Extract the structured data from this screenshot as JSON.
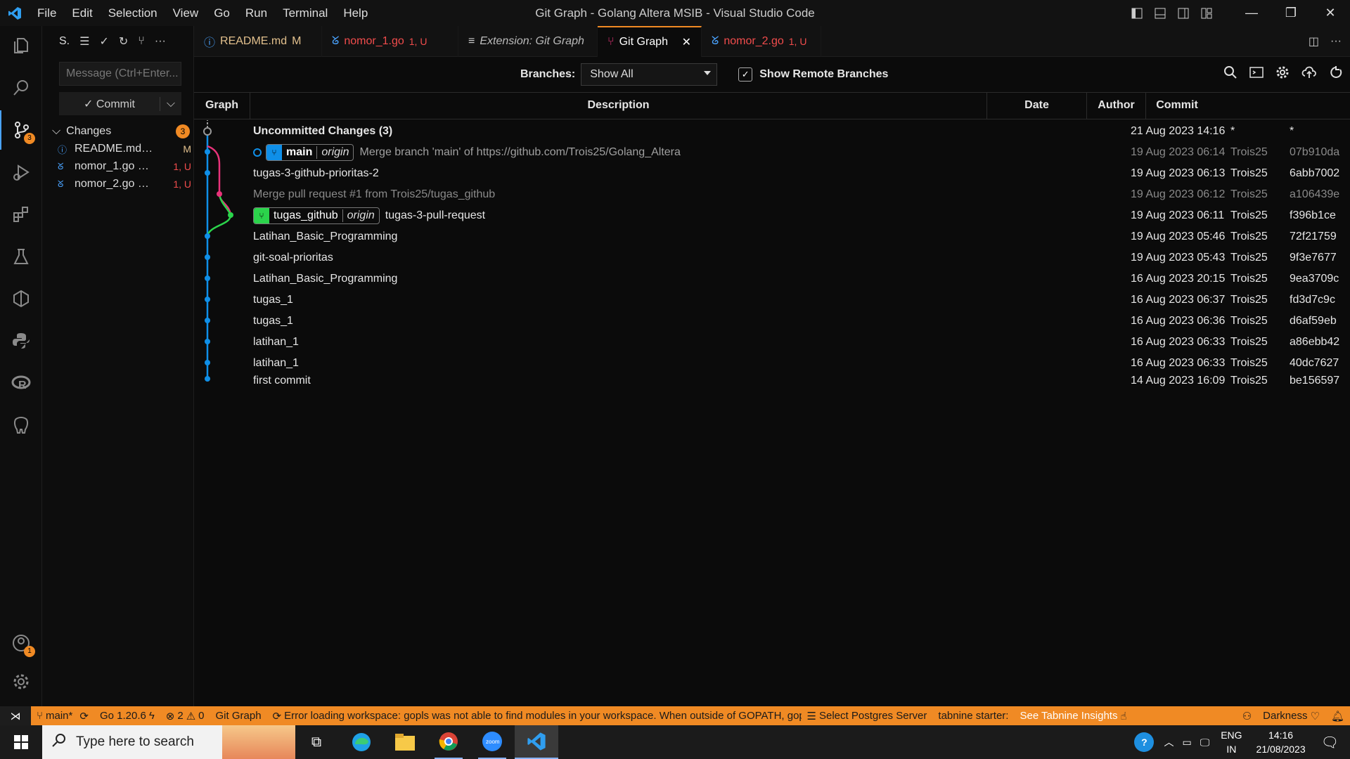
{
  "window": {
    "title": "Git Graph - Golang Altera MSIB - Visual Studio Code"
  },
  "menu": [
    "File",
    "Edit",
    "Selection",
    "View",
    "Go",
    "Run",
    "Terminal",
    "Help"
  ],
  "scm": {
    "title_initial": "S.",
    "message_placeholder": "Message (Ctrl+Enter...",
    "commit_label": "Commit",
    "changes_label": "Changes",
    "changes_count": "3",
    "files": [
      {
        "name": "README.md",
        "path": "4_...",
        "status": "M"
      },
      {
        "name": "nomor_1.go",
        "path": "4...",
        "status": "1, U"
      },
      {
        "name": "nomor_2.go",
        "path": "4...",
        "status": "1, U"
      }
    ]
  },
  "tabs": [
    {
      "label": "README.md",
      "status": "M"
    },
    {
      "label": "nomor_1.go",
      "status": "1, U"
    },
    {
      "label": "Extension: Git Graph",
      "status": ""
    },
    {
      "label": "Git Graph",
      "status": ""
    },
    {
      "label": "nomor_2.go",
      "status": "1, U"
    }
  ],
  "controls": {
    "branches_label": "Branches:",
    "branches_value": "Show All",
    "show_remote_label": "Show Remote Branches"
  },
  "columns": {
    "graph": "Graph",
    "description": "Description",
    "date": "Date",
    "author": "Author",
    "commit": "Commit"
  },
  "rows": [
    {
      "desc": "Uncommitted Changes (3)",
      "date": "21 Aug 2023 14:16",
      "author": "*",
      "hash": "*"
    },
    {
      "branch": "main",
      "remote": "origin",
      "desc": "Merge branch 'main' of https://github.com/Trois25/Golang_Altera",
      "date": "19 Aug 2023 06:14",
      "author": "Trois25",
      "hash": "07b910da"
    },
    {
      "desc": "tugas-3-github-prioritas-2",
      "date": "19 Aug 2023 06:13",
      "author": "Trois25",
      "hash": "6abb7002"
    },
    {
      "desc": "Merge pull request #1 from Trois25/tugas_github",
      "date": "19 Aug 2023 06:12",
      "author": "Trois25",
      "hash": "a106439e"
    },
    {
      "branch": "tugas_github",
      "remote": "origin",
      "desc": "tugas-3-pull-request",
      "date": "19 Aug 2023 06:11",
      "author": "Trois25",
      "hash": "f396b1ce"
    },
    {
      "desc": "Latihan_Basic_Programming",
      "date": "19 Aug 2023 05:46",
      "author": "Trois25",
      "hash": "72f21759"
    },
    {
      "desc": "git-soal-prioritas",
      "date": "19 Aug 2023 05:43",
      "author": "Trois25",
      "hash": "9f3e7677"
    },
    {
      "desc": "Latihan_Basic_Programming",
      "date": "16 Aug 2023 20:15",
      "author": "Trois25",
      "hash": "9ea3709c"
    },
    {
      "desc": "tugas_1",
      "date": "16 Aug 2023 06:37",
      "author": "Trois25",
      "hash": "fd3d7c9c"
    },
    {
      "desc": "tugas_1",
      "date": "16 Aug 2023 06:36",
      "author": "Trois25",
      "hash": "d6af59eb"
    },
    {
      "desc": "latihan_1",
      "date": "16 Aug 2023 06:33",
      "author": "Trois25",
      "hash": "a86ebb42"
    },
    {
      "desc": "latihan_1",
      "date": "16 Aug 2023 06:33",
      "author": "Trois25",
      "hash": "40dc7627"
    },
    {
      "desc": "first commit",
      "date": "14 Aug 2023 16:09",
      "author": "Trois25",
      "hash": "be156597"
    }
  ],
  "statusbar": {
    "branch": "main*",
    "go": "Go 1.20.6",
    "errors": "2",
    "warnings": "0",
    "gitgraph": "Git Graph",
    "error_msg": "Error loading workspace: gopls was not able to find modules in your workspace. When outside of GOPATH, gop",
    "postgres": "Select Postgres Server",
    "tabnine": "tabnine starter:",
    "tabnine_insights": "See Tabnine Insights",
    "theme": "Darkness"
  },
  "taskbar": {
    "search_placeholder": "Type here to search",
    "lang1": "ENG",
    "lang2": "IN",
    "time": "14:16",
    "date": "21/08/2023"
  },
  "colors": {
    "accent": "#f08a24",
    "blue": "#0f8fe8",
    "green": "#2bd44b",
    "pink": "#e8337a"
  }
}
